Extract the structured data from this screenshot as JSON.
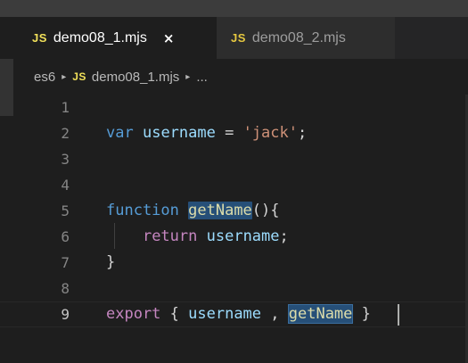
{
  "tabs": [
    {
      "icon": "JS",
      "label": "demo08_1.mjs",
      "close": "×",
      "active": true
    },
    {
      "icon": "JS",
      "label": "demo08_2.mjs",
      "active": false
    }
  ],
  "breadcrumb": {
    "folder": "es6",
    "separator": "▸",
    "file_icon": "JS",
    "file": "demo08_1.mjs",
    "more": "..."
  },
  "editor": {
    "line_numbers": [
      "1",
      "2",
      "3",
      "4",
      "5",
      "6",
      "7",
      "8",
      "9"
    ],
    "current_line": "9",
    "lines": {
      "l2": {
        "kw": "var",
        "var": "username",
        "op": " = ",
        "str": "'jack'",
        "end": ";"
      },
      "l5": {
        "kw": "function",
        "fn": "getName",
        "end": "(){"
      },
      "l6": {
        "kw": "return",
        "var": "username",
        "end": ";"
      },
      "l7": {
        "end": "}"
      },
      "l9": {
        "kw": "export",
        "open": " { ",
        "var": "username",
        "sep": " , ",
        "fn": "getName",
        "close": " }"
      }
    }
  }
}
